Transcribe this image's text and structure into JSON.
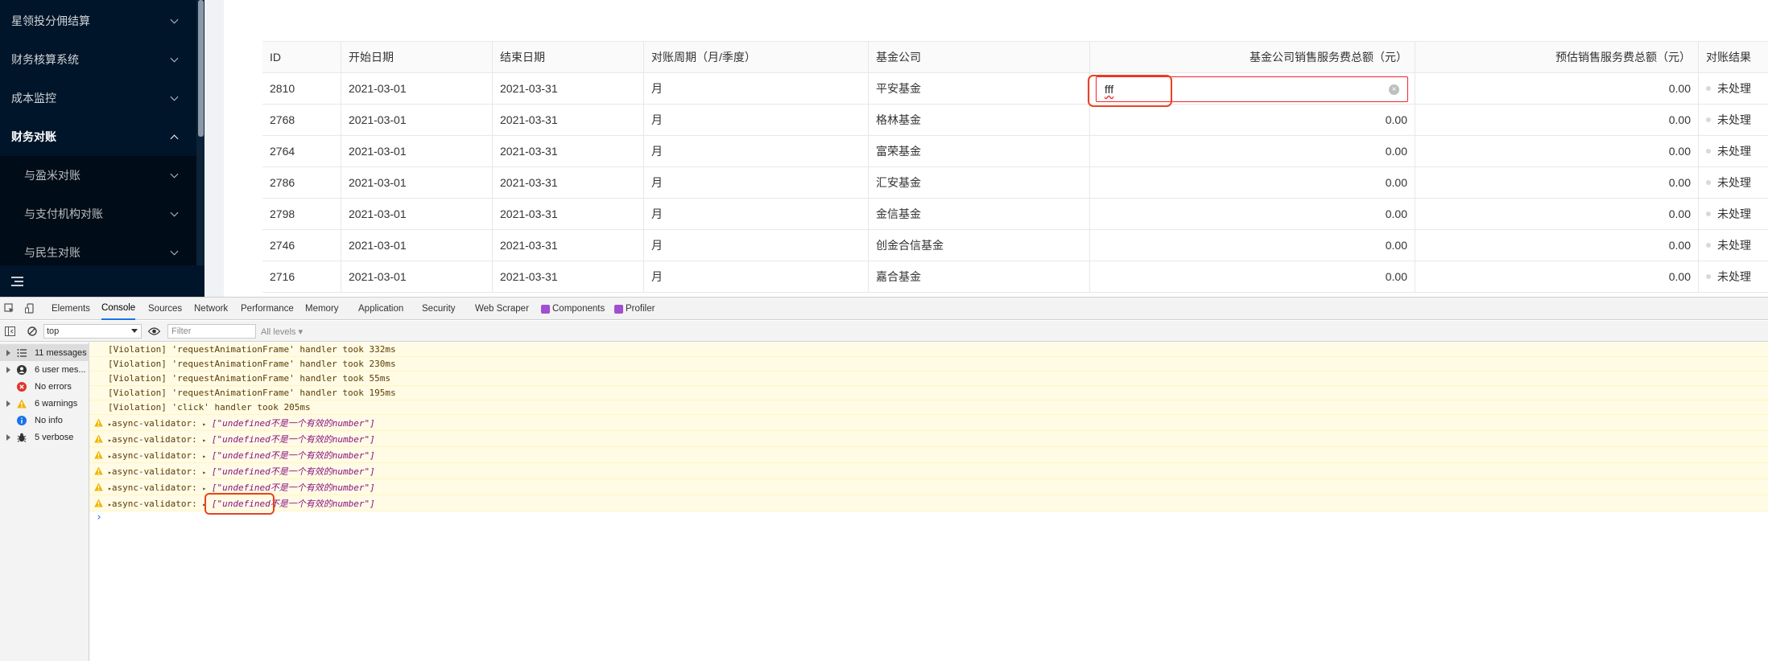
{
  "sidebar": {
    "items": [
      {
        "label": "星领投分佣结算",
        "open": false
      },
      {
        "label": "财务核算系统",
        "open": false
      },
      {
        "label": "成本监控",
        "open": false
      },
      {
        "label": "财务对账",
        "open": true
      }
    ],
    "sub_items": [
      {
        "label": "与盈米对账"
      },
      {
        "label": "与支付机构对账"
      },
      {
        "label": "与民生对账"
      }
    ]
  },
  "table": {
    "headers": [
      "ID",
      "开始日期",
      "结束日期",
      "对账周期（月/季度）",
      "基金公司",
      "基金公司销售服务费总额（元）",
      "预估销售服务费总额（元）",
      "对账结果"
    ],
    "editing_value": "fff",
    "rows": [
      {
        "id": "2810",
        "start": "2021-03-01",
        "end": "2021-03-31",
        "period": "月",
        "company": "平安基金",
        "fee": "",
        "est": "0.00",
        "status": "未处理"
      },
      {
        "id": "2768",
        "start": "2021-03-01",
        "end": "2021-03-31",
        "period": "月",
        "company": "格林基金",
        "fee": "0.00",
        "est": "0.00",
        "status": "未处理"
      },
      {
        "id": "2764",
        "start": "2021-03-01",
        "end": "2021-03-31",
        "period": "月",
        "company": "富荣基金",
        "fee": "0.00",
        "est": "0.00",
        "status": "未处理"
      },
      {
        "id": "2786",
        "start": "2021-03-01",
        "end": "2021-03-31",
        "period": "月",
        "company": "汇安基金",
        "fee": "0.00",
        "est": "0.00",
        "status": "未处理"
      },
      {
        "id": "2798",
        "start": "2021-03-01",
        "end": "2021-03-31",
        "period": "月",
        "company": "金信基金",
        "fee": "0.00",
        "est": "0.00",
        "status": "未处理"
      },
      {
        "id": "2746",
        "start": "2021-03-01",
        "end": "2021-03-31",
        "period": "月",
        "company": "创金合信基金",
        "fee": "0.00",
        "est": "0.00",
        "status": "未处理"
      },
      {
        "id": "2716",
        "start": "2021-03-01",
        "end": "2021-03-31",
        "period": "月",
        "company": "嘉合基金",
        "fee": "0.00",
        "est": "0.00",
        "status": "未处理"
      }
    ]
  },
  "devtools": {
    "tabs": [
      "Elements",
      "Console",
      "Sources",
      "Network",
      "Performance",
      "Memory",
      "Application",
      "Security",
      "Web Scraper",
      "Components",
      "Profiler"
    ],
    "active_tab": "Console",
    "context": "top",
    "filter_placeholder": "Filter",
    "levels": "All levels ▾",
    "sidebar": [
      {
        "label": "11 messages",
        "icon": "list-icon"
      },
      {
        "label": "6 user mes...",
        "icon": "user-icon"
      },
      {
        "label": "No errors",
        "icon": "error-icon"
      },
      {
        "label": "6 warnings",
        "icon": "warning-icon"
      },
      {
        "label": "No info",
        "icon": "info-icon"
      },
      {
        "label": "5 verbose",
        "icon": "bug-icon"
      }
    ],
    "messages": [
      {
        "type": "violation",
        "text": "[Violation] 'requestAnimationFrame' handler took 332ms"
      },
      {
        "type": "violation",
        "text": "[Violation] 'requestAnimationFrame' handler took 230ms"
      },
      {
        "type": "violation",
        "text": "[Violation] 'requestAnimationFrame' handler took 55ms"
      },
      {
        "type": "violation",
        "text": "[Violation] 'requestAnimationFrame' handler took 195ms"
      },
      {
        "type": "violation",
        "text": "[Violation] 'click' handler took 205ms"
      },
      {
        "type": "warning",
        "prefix": "async-validator:",
        "value": "[\"undefined不是一个有效的number\"]"
      },
      {
        "type": "warning",
        "prefix": "async-validator:",
        "value": "[\"undefined不是一个有效的number\"]"
      },
      {
        "type": "warning",
        "prefix": "async-validator:",
        "value": "[\"undefined不是一个有效的number\"]"
      },
      {
        "type": "warning",
        "prefix": "async-validator:",
        "value": "[\"undefined不是一个有效的number\"]"
      },
      {
        "type": "warning",
        "prefix": "async-validator:",
        "value": "[\"undefined不是一个有效的number\"]"
      },
      {
        "type": "warning",
        "prefix": "async-validator:",
        "value": "[\"undefined不是一个有效的number\"]"
      }
    ],
    "prompt": "›"
  },
  "colors": {
    "sidebar_bg": "#001529",
    "accent": "#1a73e8",
    "error_red": "#f5222d",
    "warn_bg": "#fffbe5"
  }
}
